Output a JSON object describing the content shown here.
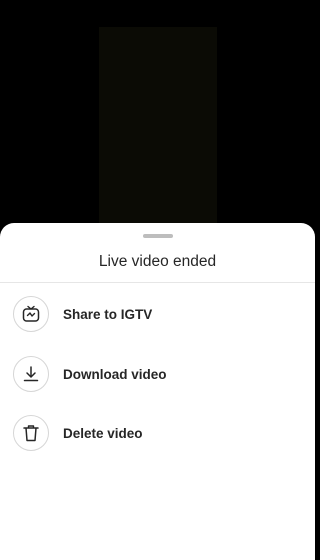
{
  "sheet": {
    "title": "Live video ended",
    "options": [
      {
        "label": "Share to IGTV",
        "icon": "igtv-icon"
      },
      {
        "label": "Download video",
        "icon": "download-icon"
      },
      {
        "label": "Delete video",
        "icon": "trash-icon"
      }
    ]
  }
}
